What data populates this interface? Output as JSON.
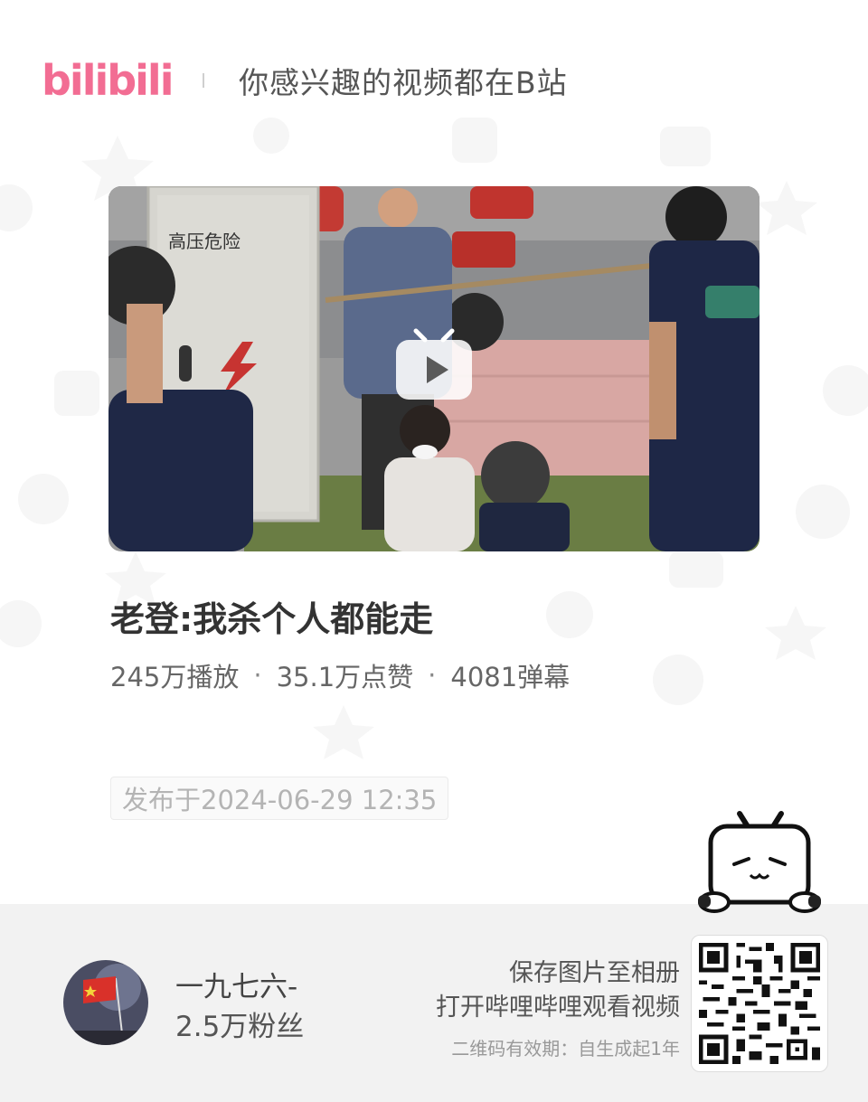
{
  "header": {
    "logo_text": "bilibili",
    "slogan": "你感兴趣的视频都在B站"
  },
  "video": {
    "thumbnail_sign": "高压危险",
    "play_icon": "bilibili-tv-play-icon",
    "title": "老登:我杀个人都能走",
    "stats": {
      "plays": "245万播放",
      "likes": "35.1万点赞",
      "danmaku": "4081弹幕",
      "separator": "·"
    },
    "published": "发布于2024-06-29 12:35"
  },
  "uploader": {
    "name": "一九七六-",
    "fans": "2.5万粉丝",
    "avatar_icon": "flag-avatar-icon"
  },
  "share": {
    "line1": "保存图片至相册",
    "line2": "打开哔哩哔哩观看视频",
    "line3": "二维码有效期：自生成起1年",
    "qr_icon": "qr-code-icon"
  },
  "colors": {
    "brand_pink": "#f26d93",
    "footer_bg": "#f2f2f2"
  }
}
